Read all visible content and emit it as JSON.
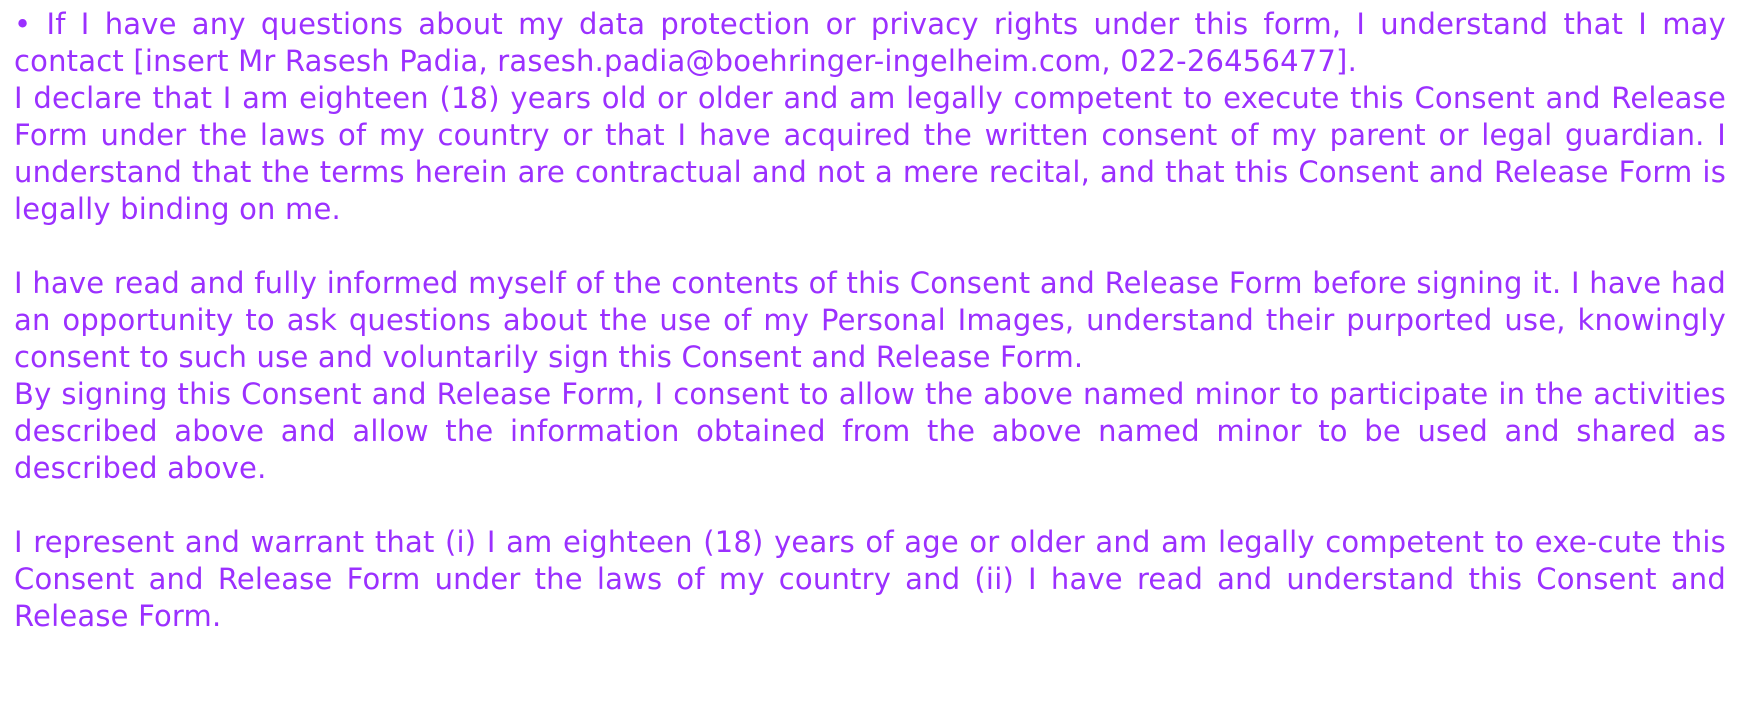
{
  "document": {
    "paragraphs": [
      {
        "id": "contact",
        "text": "• If I have any questions about my data protection or privacy rights under this form, I understand that I may contact [insert Mr Rasesh Padia, rasesh.padia@boehringer-ingelheim.com, 022-26456477]."
      },
      {
        "id": "age-declaration",
        "text": "I declare that I am eighteen (18) years old or older and am legally competent to execute this Consent and Release Form under the laws of my country or that I have acquired the written consent of my parent or legal guardian. I understand that the terms herein are contractual and not a mere recital, and that this Consent and Release Form is legally binding on me."
      },
      {
        "id": "read-informed",
        "text": "I have read and fully informed myself of the contents of this Consent and Release Form before signing it. I have had an opportunity to ask questions about the use of my Personal Images, understand their purported use, knowingly consent to such use and voluntarily sign this Consent and Release Form."
      },
      {
        "id": "minor-consent",
        "text": "By signing this Consent and Release Form, I consent to allow the above named minor to participate in the activities described above and allow the information obtained from the above named minor to be used and shared as described above."
      },
      {
        "id": "represent-warrant",
        "text": "I represent and warrant that (i) I am eighteen (18) years of age or older and am legally competent to exe-cute this Consent and Release Form under the laws of my country and (ii) I have read and understand this Consent and Release Form."
      }
    ]
  },
  "colors": {
    "text": "#9b30ff",
    "background": "#ffffff"
  }
}
